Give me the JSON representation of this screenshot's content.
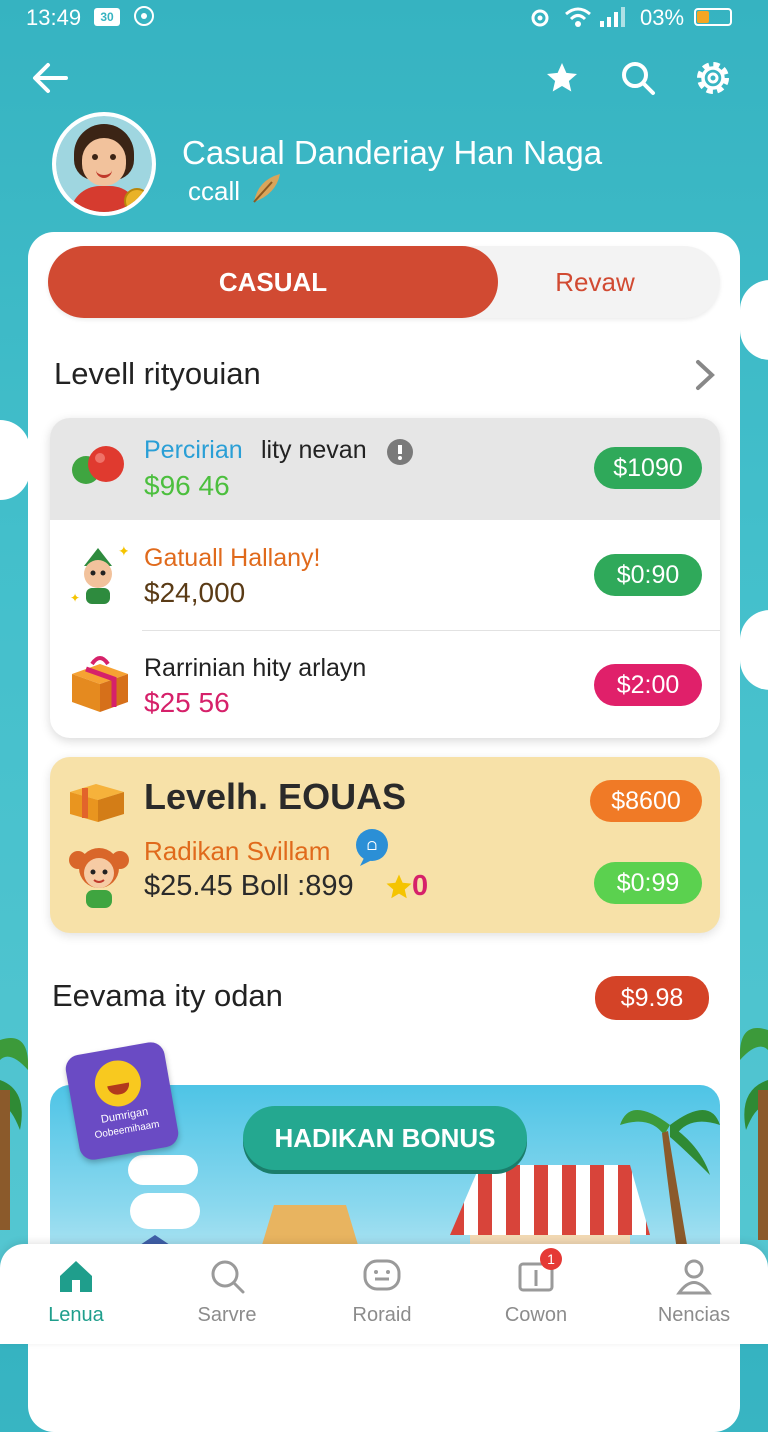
{
  "status_bar": {
    "time": "13:49",
    "badge": "30",
    "battery": "03%"
  },
  "header": {
    "title": "Casual Danderiay Han Naga",
    "subtitle": "ccall"
  },
  "tabs": [
    {
      "label": "CASUAL",
      "active": true
    },
    {
      "label": "Revaw",
      "active": false
    }
  ],
  "section1": {
    "title": "Levell rityouian",
    "items": [
      {
        "name": "Percirian",
        "name_rest": "lity nevan",
        "amount": "$96 46",
        "price": "$1090",
        "name_color": "#2a9fd6",
        "amount_color": "#4cbf3e",
        "price_color": "#2fa95a"
      },
      {
        "name": "Gatuall Hallany!",
        "amount": "$24,000",
        "price": "$0:90",
        "name_color": "#e06a1c",
        "amount_color": "#5a3b16",
        "price_color": "#2fa95a"
      },
      {
        "name": "Rarrinian hity arlayn",
        "amount": "$25 56",
        "price": "$2:00",
        "name_color": "#222222",
        "amount_color": "#d6216a",
        "price_color": "#e0206a"
      }
    ]
  },
  "featured": {
    "title": "Levelh. EOUAS",
    "title_price": "$8600",
    "sub_name": "Radikan Svillam",
    "sub_amount": "$25.45 Boll :899",
    "sub_tail": "0",
    "sub_price": "$0:99"
  },
  "section2": {
    "title": "Eevama ity odan",
    "price": "$9.98"
  },
  "banner": {
    "button": "HADIKAN BONUS",
    "sticker_line1": "Dumrigan",
    "sticker_line2": "Oobeemihaam"
  },
  "nav": [
    {
      "label": "Lenua",
      "icon": "home-icon",
      "active": true
    },
    {
      "label": "Sarvre",
      "icon": "search-icon",
      "active": false
    },
    {
      "label": "Roraid",
      "icon": "chat-icon",
      "active": false
    },
    {
      "label": "Cowon",
      "icon": "coupon-icon",
      "active": false,
      "badge": "1"
    },
    {
      "label": "Nencias",
      "icon": "profile-icon",
      "active": false
    }
  ],
  "colors": {
    "teal_bg": "#36b3c1",
    "accent_red": "#d14a32",
    "active_nav": "#1f9e8c"
  }
}
